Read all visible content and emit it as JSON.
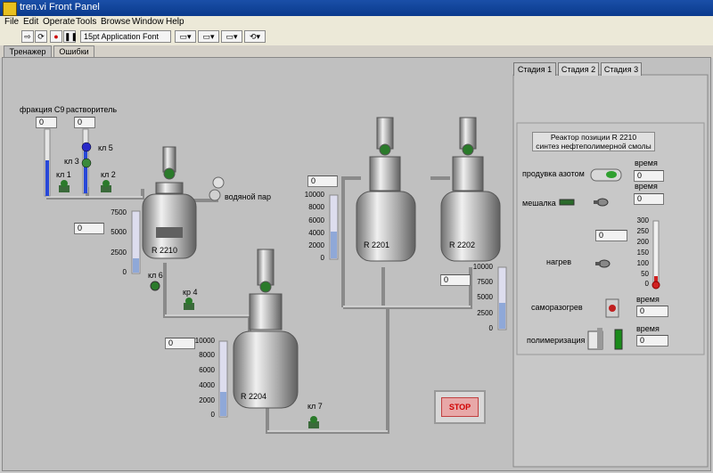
{
  "window": {
    "title": "tren.vi Front Panel"
  },
  "menu": [
    "File",
    "Edit",
    "Operate",
    "Tools",
    "Browse",
    "Window",
    "Help"
  ],
  "toolbar": {
    "font_label": "15pt Application Font"
  },
  "tabs": [
    "Тренажер",
    "Ошибки"
  ],
  "stage_tabs": [
    "Стадия 1",
    "Стадия 2",
    "Стадия 3"
  ],
  "feeds": {
    "c9_label": "фракция C9",
    "c9_value": "0",
    "solvent_label": "растворитель",
    "solvent_value": "0"
  },
  "valves": {
    "kl1": "кл 1",
    "kl2": "кл 2",
    "kl3": "кл 3",
    "kl5": "кл 5",
    "kl6": "кл 6",
    "kr4": "кр 4",
    "kl7": "кл 7"
  },
  "steam_label": "водяной пар",
  "reactors": {
    "r2210": {
      "label": "R 2210",
      "value": "0",
      "ticks": [
        "7500",
        "5000",
        "2500",
        "0"
      ]
    },
    "r2204": {
      "label": "R 2204",
      "value": "0",
      "ticks": [
        "10000",
        "8000",
        "6000",
        "4000",
        "2000",
        "0"
      ]
    },
    "r2201": {
      "label": "R 2201",
      "value": "0",
      "ticks": [
        "10000",
        "8000",
        "6000",
        "4000",
        "2000",
        "0"
      ]
    },
    "r2202": {
      "label": "R 2202",
      "value": "0",
      "ticks": [
        "10000",
        "7500",
        "5000",
        "2500",
        "0"
      ]
    }
  },
  "control": {
    "title_line1": "Реактор позиции R 2210",
    "title_line2": "синтез нефтеполимерной смолы",
    "nitrogen_label": "продувка азотом",
    "time_label": "время",
    "nitrogen_time": "0",
    "stirrer_label": "мешалка",
    "stirrer_time": "0",
    "heating_value": "0",
    "heating_label": "нагрев",
    "temp_ticks": [
      "300",
      "250",
      "200",
      "150",
      "100",
      "50",
      "0"
    ],
    "selfheat_label": "саморазогрев",
    "selfheat_time": "0",
    "polymer_label": "полимеризация",
    "polymer_time": "0"
  },
  "stop_label": "STOP",
  "colors": {
    "title_bar": "#0a3a8c",
    "tank_blue": "#2848d8",
    "led_green": "#30c030",
    "stop_red": "#d00000"
  }
}
